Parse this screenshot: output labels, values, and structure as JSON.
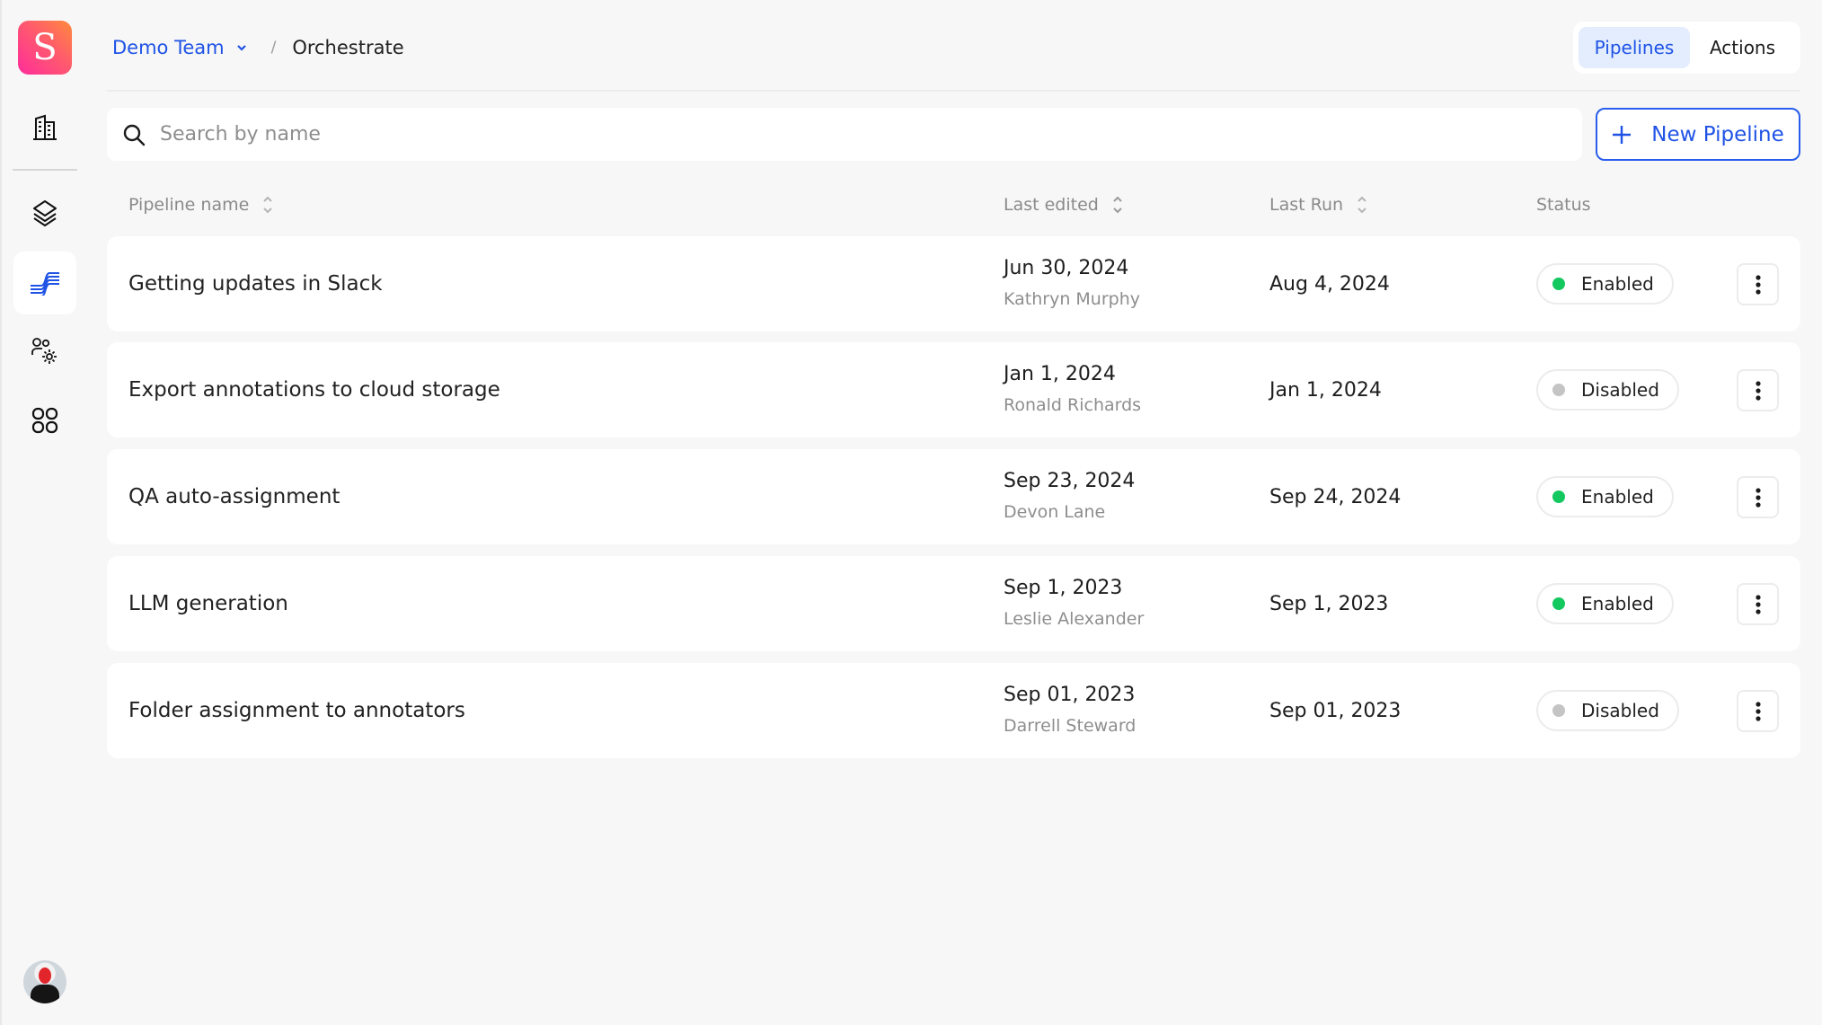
{
  "app": {
    "logo_letter": "S",
    "brand_gradient": [
      "#ff2d9b",
      "#ff8a3c"
    ]
  },
  "sidebar": {
    "items": [
      {
        "name": "organization",
        "icon": "building-icon",
        "active": false
      },
      {
        "name": "datasets",
        "icon": "layers-icon",
        "active": false
      },
      {
        "name": "orchestrate",
        "icon": "orchestrate-icon",
        "active": true
      },
      {
        "name": "team-settings",
        "icon": "users-gear-icon",
        "active": false
      },
      {
        "name": "apps",
        "icon": "grid-icon",
        "active": false
      }
    ],
    "avatar": "user-avatar"
  },
  "breadcrumb": {
    "team": "Demo Team",
    "separator": "/",
    "current": "Orchestrate"
  },
  "view_toggle": {
    "options": [
      "Pipelines",
      "Actions"
    ],
    "selected": "Pipelines"
  },
  "search": {
    "placeholder": "Search by name",
    "value": ""
  },
  "new_pipeline_button": {
    "label": "New Pipeline",
    "icon": "plus-icon"
  },
  "table": {
    "columns": [
      {
        "label": "Pipeline name",
        "sortable": true
      },
      {
        "label": "Last edited",
        "sortable": true
      },
      {
        "label": "Last Run",
        "sortable": true
      },
      {
        "label": "Status",
        "sortable": false
      }
    ],
    "rows": [
      {
        "name": "Getting updates in Slack",
        "last_edited": "Jun 30, 2024",
        "edited_by": "Kathryn Murphy",
        "last_run": "Aug 4, 2024",
        "status": "Enabled"
      },
      {
        "name": "Export annotations to cloud storage",
        "last_edited": "Jan 1, 2024",
        "edited_by": "Ronald Richards",
        "last_run": "Jan 1, 2024",
        "status": "Disabled"
      },
      {
        "name": "QA auto-assignment",
        "last_edited": "Sep 23, 2024",
        "edited_by": "Devon Lane",
        "last_run": "Sep 24, 2024",
        "status": "Enabled"
      },
      {
        "name": "LLM generation",
        "last_edited": "Sep 1, 2023",
        "edited_by": "Leslie Alexander",
        "last_run": "Sep 1, 2023",
        "status": "Enabled"
      },
      {
        "name": "Folder assignment to annotators",
        "last_edited": "Sep 01, 2023",
        "edited_by": "Darrell Steward",
        "last_run": "Sep 01, 2023",
        "status": "Disabled"
      }
    ]
  },
  "colors": {
    "accent": "#1f53e6",
    "enabled": "#12c85f",
    "disabled": "#c4c4c4",
    "toggle_active_bg": "#e3edfd"
  }
}
